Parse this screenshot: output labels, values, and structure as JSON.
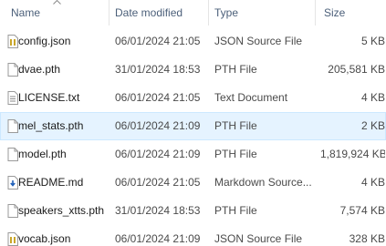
{
  "columns": {
    "name": "Name",
    "date": "Date modified",
    "type": "Type",
    "size": "Size"
  },
  "files": [
    {
      "name": "config.json",
      "date": "06/01/2024 21:05",
      "type": "JSON Source File",
      "size": "5 KB",
      "icon": "json-file-icon"
    },
    {
      "name": "dvae.pth",
      "date": "31/01/2024 18:53",
      "type": "PTH File",
      "size": "205,581 KB",
      "icon": "generic-file-icon"
    },
    {
      "name": "LICENSE.txt",
      "date": "06/01/2024 21:05",
      "type": "Text Document",
      "size": "4 KB",
      "icon": "text-file-icon"
    },
    {
      "name": "mel_stats.pth",
      "date": "06/01/2024 21:09",
      "type": "PTH File",
      "size": "2 KB",
      "icon": "generic-file-icon",
      "selected": true
    },
    {
      "name": "model.pth",
      "date": "06/01/2024 21:09",
      "type": "PTH File",
      "size": "1,819,924 KB",
      "icon": "generic-file-icon"
    },
    {
      "name": "README.md",
      "date": "06/01/2024 21:05",
      "type": "Markdown Source...",
      "size": "4 KB",
      "icon": "markdown-file-icon"
    },
    {
      "name": "speakers_xtts.pth",
      "date": "31/01/2024 18:53",
      "type": "PTH File",
      "size": "7,574 KB",
      "icon": "generic-file-icon"
    },
    {
      "name": "vocab.json",
      "date": "06/01/2024 21:09",
      "type": "JSON Source File",
      "size": "328 KB",
      "icon": "json-file-icon"
    }
  ],
  "colors": {
    "selection_bg": "#e5f3ff",
    "selection_border": "#cce8ff",
    "header_text": "#4c607a",
    "json_icon": "#c8a52a",
    "markdown_icon": "#1f5fb8"
  }
}
